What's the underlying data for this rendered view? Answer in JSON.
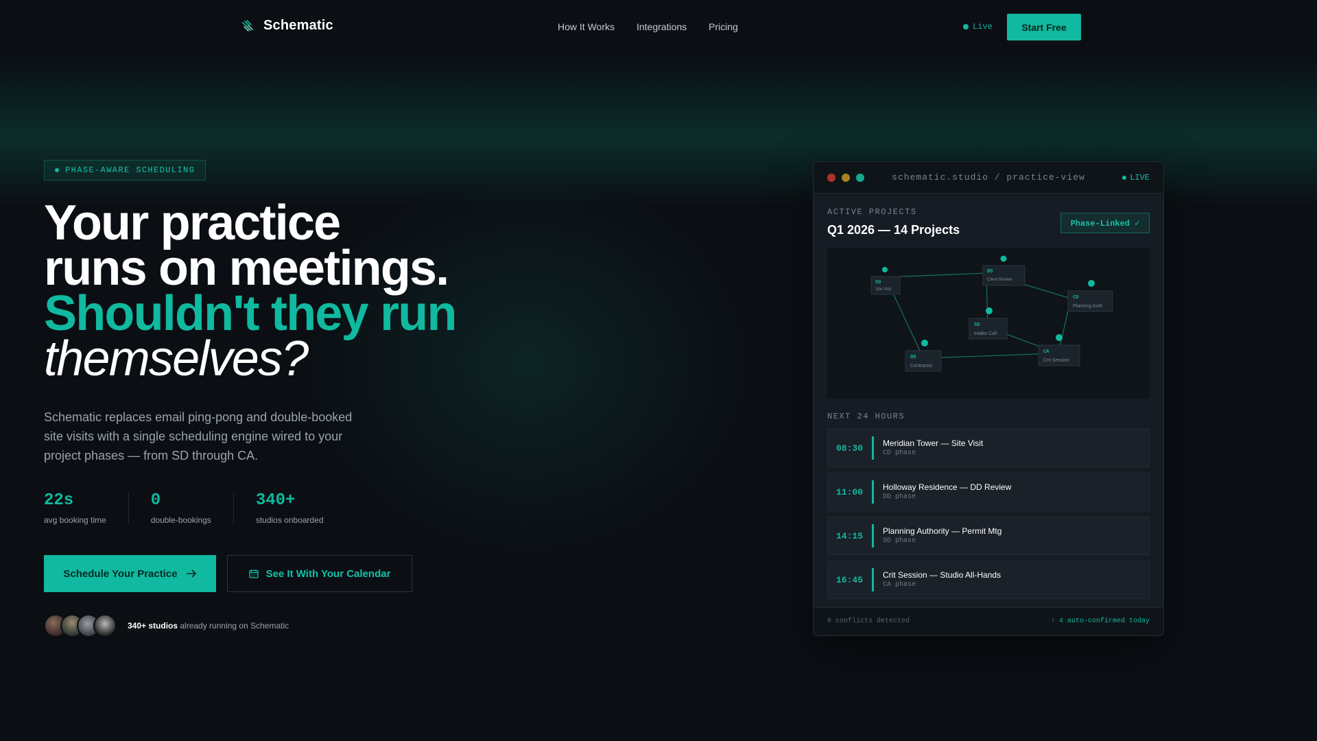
{
  "nav": {
    "brand": "Schematic",
    "links": [
      "How It Works",
      "Integrations",
      "Pricing"
    ],
    "live_label": "Live",
    "cta": "Start Free"
  },
  "hero": {
    "badge": "PHASE-AWARE SCHEDULING",
    "headline_line1": "Your practice",
    "headline_line2": "runs on meetings.",
    "headline_accent": "Shouldn't they run",
    "headline_italic": "themselves?",
    "subtitle": "Schematic replaces email ping-pong and double-booked site visits with a single scheduling engine wired to your project phases — from SD through CA.",
    "stats": [
      {
        "value": "22s",
        "label": "avg booking time"
      },
      {
        "value": "0",
        "label": "double-bookings"
      },
      {
        "value": "340+",
        "label": "studios onboarded"
      }
    ],
    "cta_primary": "Schedule Your Practice",
    "cta_secondary": "See It With Your Calendar",
    "social_bold": "340+ studios",
    "social_text": " already running on Schematic"
  },
  "panel": {
    "url": "schematic.studio / practice-view",
    "live": "LIVE",
    "section_label": "ACTIVE PROJECTS",
    "title": "Q1 2026 — 14 Projects",
    "badge": "Phase-Linked ✓",
    "graph_nodes": [
      {
        "code": "SD",
        "name": "Site Visit"
      },
      {
        "code": "DD",
        "name": "Client Review"
      },
      {
        "code": "CD",
        "name": "Planning Auth"
      },
      {
        "code": "SD",
        "name": "Intake Call"
      },
      {
        "code": "DD",
        "name": "Contractor"
      },
      {
        "code": "CA",
        "name": "Crit Session"
      }
    ],
    "next_label": "NEXT 24 HOURS",
    "meetings": [
      {
        "time": "08:30",
        "title": "Meridian Tower — Site Visit",
        "phase": "CD phase"
      },
      {
        "time": "11:00",
        "title": "Holloway Residence — DD Review",
        "phase": "DD phase"
      },
      {
        "time": "14:15",
        "title": "Planning Authority — Permit Mtg",
        "phase": "SD phase"
      },
      {
        "time": "16:45",
        "title": "Crit Session — Studio All-Hands",
        "phase": "CA phase"
      }
    ],
    "footer_left": "0 conflicts detected",
    "footer_right": "↑ 4 auto-confirmed today"
  },
  "colors": {
    "accent": "#10b99f",
    "background": "#0b0f14",
    "panel": "#161c23"
  }
}
